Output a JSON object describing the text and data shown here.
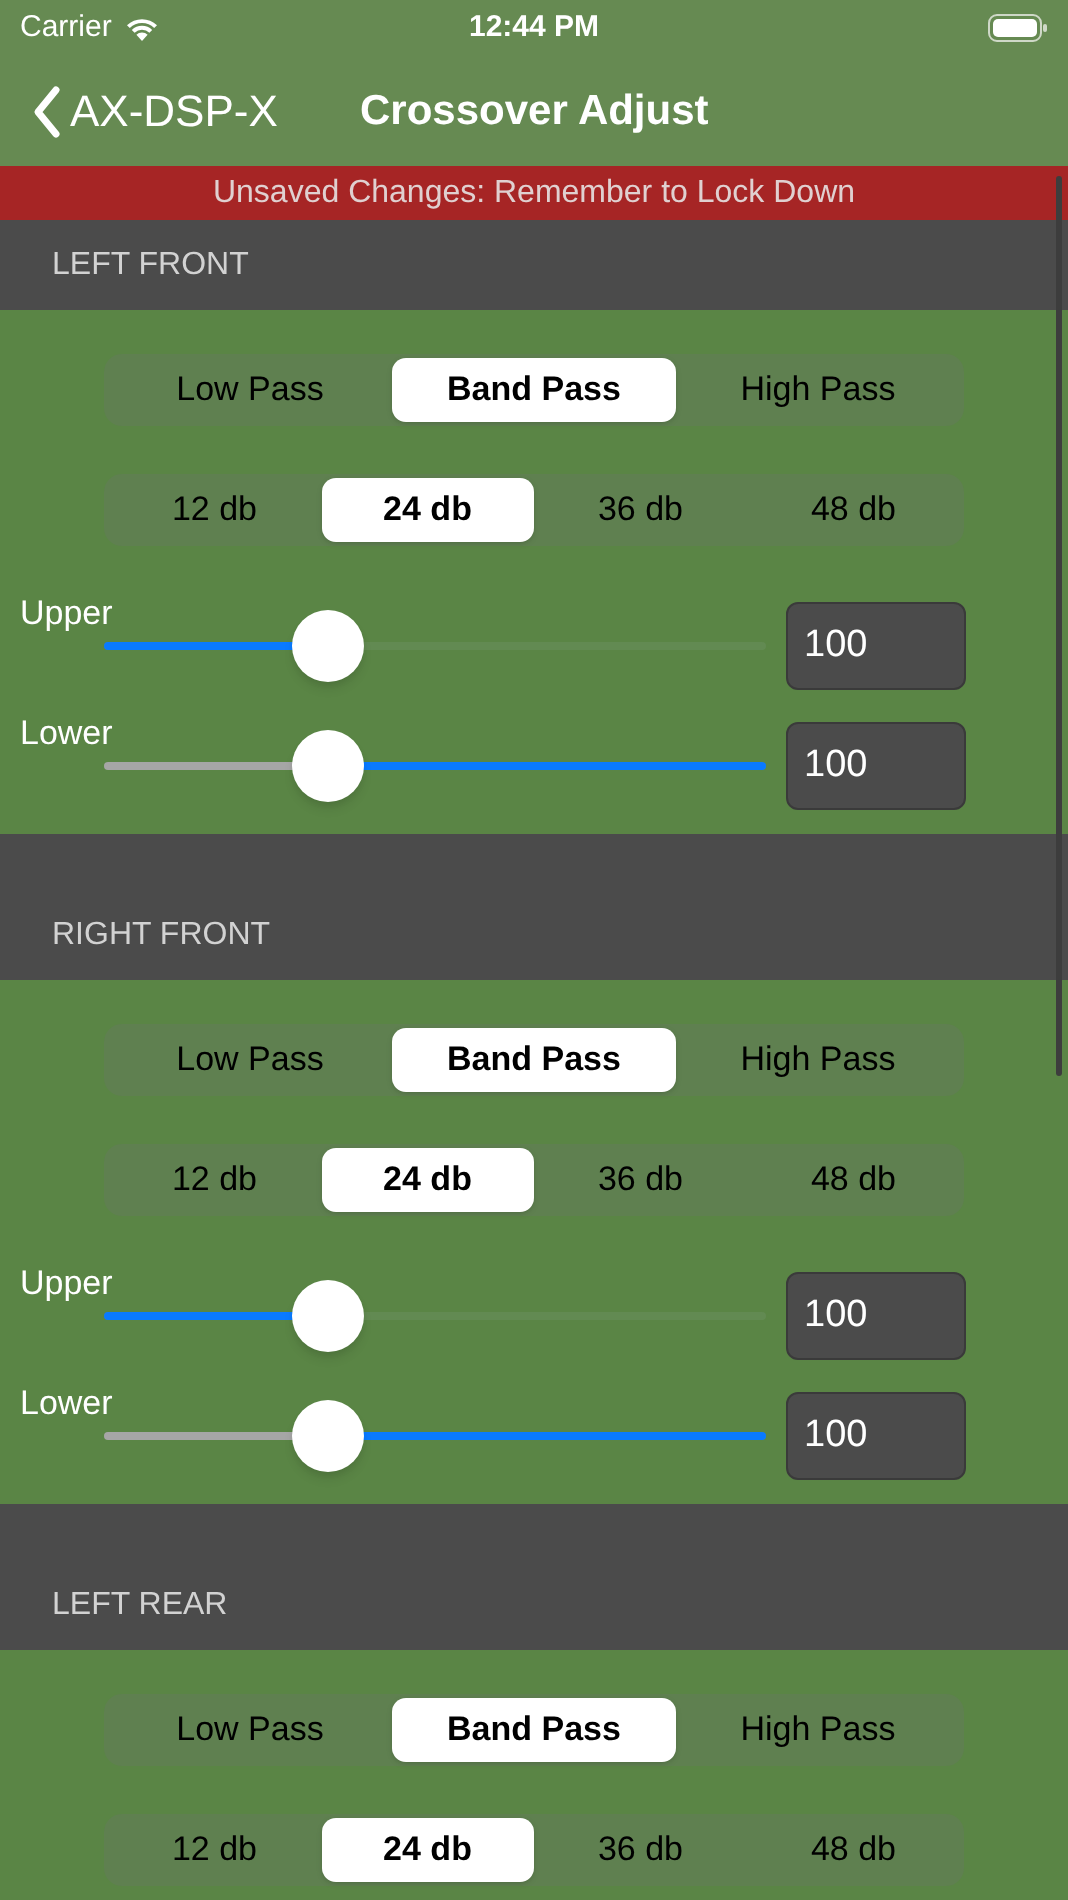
{
  "status_bar": {
    "carrier": "Carrier",
    "time": "12:44 PM"
  },
  "nav": {
    "back": "AX-DSP-X",
    "title": "Crossover Adjust"
  },
  "banner": "Unsaved Changes: Remember to Lock Down",
  "sections": [
    {
      "title": "LEFT FRONT",
      "filters": [
        {
          "label": "Low Pass",
          "selected": false
        },
        {
          "label": "Band Pass",
          "selected": true
        },
        {
          "label": "High Pass",
          "selected": false
        }
      ],
      "slopes": [
        {
          "label": "12 db",
          "selected": false
        },
        {
          "label": "24 db",
          "selected": true
        },
        {
          "label": "36 db",
          "selected": false
        },
        {
          "label": "48 db",
          "selected": false
        }
      ],
      "sliders": [
        {
          "kind": "upper",
          "label": "Upper",
          "level": 0.32,
          "value": "100"
        },
        {
          "kind": "lower",
          "label": "Lower",
          "level": 0.32,
          "value": "100"
        }
      ]
    },
    {
      "title": "RIGHT FRONT",
      "filters": [
        {
          "label": "Low Pass",
          "selected": false
        },
        {
          "label": "Band Pass",
          "selected": true
        },
        {
          "label": "High Pass",
          "selected": false
        }
      ],
      "slopes": [
        {
          "label": "12 db",
          "selected": false
        },
        {
          "label": "24 db",
          "selected": true
        },
        {
          "label": "36 db",
          "selected": false
        },
        {
          "label": "48 db",
          "selected": false
        }
      ],
      "sliders": [
        {
          "kind": "upper",
          "label": "Upper",
          "level": 0.32,
          "value": "100"
        },
        {
          "kind": "lower",
          "label": "Lower",
          "level": 0.32,
          "value": "100"
        }
      ]
    },
    {
      "title": "LEFT REAR",
      "filters": [
        {
          "label": "Low Pass",
          "selected": false
        },
        {
          "label": "Band Pass",
          "selected": true
        },
        {
          "label": "High Pass",
          "selected": false
        }
      ],
      "slopes": [
        {
          "label": "12 db",
          "selected": false
        },
        {
          "label": "24 db",
          "selected": true
        },
        {
          "label": "36 db",
          "selected": false
        },
        {
          "label": "48 db",
          "selected": false
        }
      ]
    }
  ]
}
